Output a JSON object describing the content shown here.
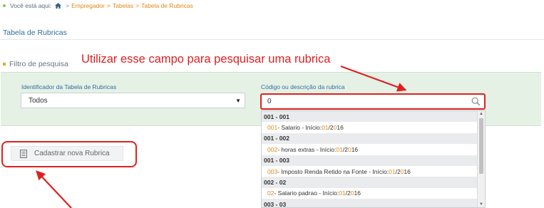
{
  "breadcrumb": {
    "prefix": "Você está aqui:",
    "items": [
      "Empregador",
      "Tabelas",
      "Tabela de Rubricas"
    ],
    "separator": ">"
  },
  "page": {
    "title": "Tabela de Rubricas"
  },
  "filter": {
    "section_label": "Filtro de pesquisa",
    "table_id_label": "Identificador da Tabela de Rubricas",
    "table_id_value": "Todos",
    "search_label": "Código ou descrição da rubrica",
    "search_value": "0"
  },
  "dropdown": {
    "groups": [
      {
        "header": "001 - 001",
        "option": {
          "code": "001",
          "desc": " - Salario - Início: ",
          "month": "01",
          "slash": "/",
          "y1": "2",
          "y2": "0",
          "y3": "16"
        }
      },
      {
        "header": "001 - 002",
        "option": {
          "code": "002",
          "desc": " - horas extras - Início: ",
          "month": "01",
          "slash": "/",
          "y1": "2",
          "y2": "0",
          "y3": "16"
        }
      },
      {
        "header": "001 - 003",
        "option": {
          "code": "003",
          "desc": " - Imposto Renda Retido na Fonte - Início: ",
          "month": "01",
          "slash": "/",
          "y1": "2",
          "y2": "0",
          "y3": "16"
        }
      },
      {
        "header": "002 - 02",
        "option": {
          "code": "02",
          "desc": " - Salario padrao - Início: ",
          "month": "01",
          "slash": "/",
          "y1": "2",
          "y2": "0",
          "y3": "16"
        }
      }
    ],
    "partial_header": "003 - 03"
  },
  "actions": {
    "new_rubrica": "Cadastrar nova Rubrica"
  },
  "annotation": {
    "text": "Utilizar esse campo para pesquisar uma rubrica"
  },
  "colors": {
    "accent_orange": "#e08a15",
    "link_blue": "#2f6ea0",
    "annotation_red": "#e02020",
    "panel_green": "#e5f1e5"
  }
}
